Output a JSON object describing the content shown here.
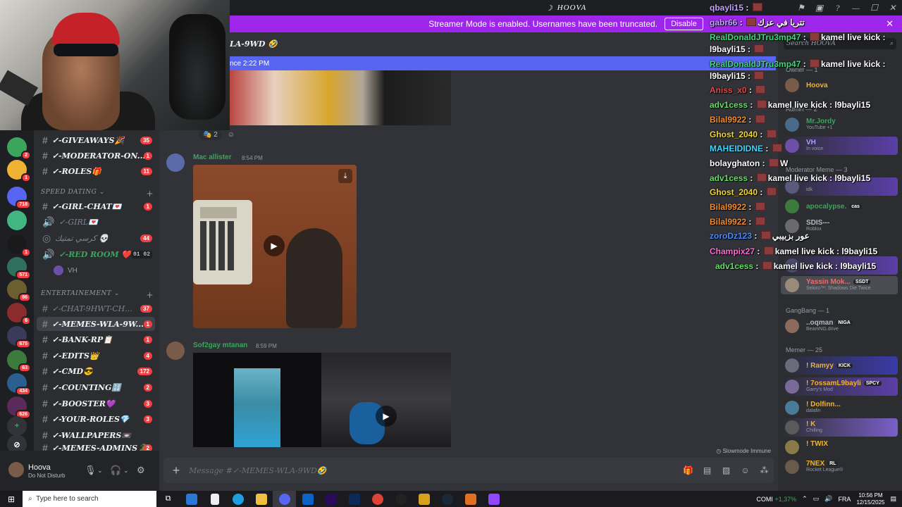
{
  "window": {
    "title": "HOOVA"
  },
  "banner": {
    "text": "Streamer Mode is enabled. Usernames have been truncated.",
    "button": "Disable"
  },
  "channel_header": {
    "title": "LA-9WD 🤣"
  },
  "new_messages": {
    "text": "nce 2:22 PM"
  },
  "reaction": {
    "count": "2"
  },
  "rail": {
    "servers": [
      {
        "badge": "2",
        "color": "#3ba55d"
      },
      {
        "badge": "1",
        "color": "#f0b232"
      },
      {
        "badge": "718",
        "color": "#5865f2"
      },
      {
        "badge": "",
        "color": "#43b581"
      },
      {
        "badge": "1",
        "color": "#1a1a1a"
      },
      {
        "badge": "571",
        "color": "#2f6f5e"
      },
      {
        "badge": "86",
        "color": "#6b5f2f"
      },
      {
        "badge": "6",
        "color": "#8b2b2b"
      },
      {
        "badge": "675",
        "color": "#3a3a5a"
      },
      {
        "badge": "63",
        "color": "#3d7a3d"
      },
      {
        "badge": "434",
        "color": "#2a5f8f"
      },
      {
        "badge": "626",
        "color": "#5a2a5a"
      }
    ]
  },
  "channels": {
    "items": [
      {
        "label": "✓-GIVEAWAYS🎉",
        "count": "35"
      },
      {
        "label": "✓-MODERATOR-ON...",
        "count": "1"
      },
      {
        "label": "✓-ROLES🎁",
        "count": "11"
      },
      {
        "label": "✓-GIRL-CHAT💌",
        "count": "1"
      },
      {
        "label": "✓-GIRL💌",
        "count": ""
      },
      {
        "label": "كرسي تمتيك 💀",
        "count": "44"
      },
      {
        "label": "✓-RED ROOM ❤️",
        "count": ""
      },
      {
        "label": "✓-CHAT-9HWT-CH...",
        "count": "37"
      },
      {
        "label": "✓-MEMES-WLA-9W...",
        "count": "1"
      },
      {
        "label": "✓-BANK-RP📋",
        "count": "1"
      },
      {
        "label": "✓-EDITS👑",
        "count": "4"
      },
      {
        "label": "✓-CMD😎",
        "count": "172"
      },
      {
        "label": "✓-COUNTING🔢",
        "count": "2"
      },
      {
        "label": "✓-BOOSTER💜",
        "count": "3"
      },
      {
        "label": "✓-YOUR-ROLES💎",
        "count": "3"
      },
      {
        "label": "✓-WALLPAPERS📼",
        "count": ""
      },
      {
        "label": "✓-MEMES-ADMINS🐊",
        "count": "2"
      }
    ],
    "cat_speed": "SPEED DATING",
    "cat_ent": "ENTERTAINEMENT",
    "vc_user": "VH",
    "vc_counts": [
      "01",
      "02"
    ]
  },
  "user": {
    "name": "Hoova",
    "status": "Do Not Disturb"
  },
  "messages": [
    {
      "author": "Mac allister",
      "time": "8:54 PM",
      "color": "#3ba55d"
    },
    {
      "author": "Sof2gay mtanan",
      "time": "8:59 PM",
      "color": "#3ba55d"
    }
  ],
  "slowmode": "Slowmode Immune",
  "composer": {
    "placeholder": "Message #✓-MEMES-WLA-9WD🤣"
  },
  "stream_chat": [
    {
      "user": "qbayli15",
      "msg": "",
      "color": "#c7a3ff"
    },
    {
      "user": "gabr66",
      "msg": "تتريا في عزك",
      "color": "#c7a3ff"
    },
    {
      "user": "RealDonaldJTru3mp47",
      "msg": "kamel live kick :",
      "color": "#3fd97a"
    },
    {
      "user": "l9bayli15",
      "msg": "",
      "color": "#ffffff"
    },
    {
      "user": "RealDonaldJTru3mp47",
      "msg": "kamel live kick :",
      "color": "#3fd97a"
    },
    {
      "user": "l9bayli15",
      "msg": "",
      "color": "#ffffff"
    },
    {
      "user": "Aniss_x0",
      "msg": "",
      "color": "#e04a4a"
    },
    {
      "user": "adv1cess",
      "msg": "kamel live kick : l9bayli15",
      "color": "#5fe35f"
    },
    {
      "user": "Bilal9922",
      "msg": "",
      "color": "#f28c2f"
    },
    {
      "user": "Ghost_2040",
      "msg": "",
      "color": "#f2d52f"
    },
    {
      "user": "MAHEIDIDNE",
      "msg": "",
      "color": "#3fd9ff"
    },
    {
      "user": "bolayghaton",
      "msg": "W",
      "color": "#ffffff"
    },
    {
      "user": "adv1cess",
      "msg": "kamel live kick : l9bayli15",
      "color": "#5fe35f"
    },
    {
      "user": "Ghost_2040",
      "msg": "",
      "color": "#f2d52f"
    },
    {
      "user": "Bilal9922",
      "msg": "",
      "color": "#f28c2f"
    },
    {
      "user": "Bilal9922",
      "msg": "",
      "color": "#f28c2f"
    },
    {
      "user": "zoroDz123",
      "msg": "عور بزبيبي",
      "color": "#4a8cff"
    },
    {
      "user": "Champix27",
      "msg": "kamel live kick : l9bayli15",
      "color": "#ff6ad5"
    },
    {
      "user": "adv1cess",
      "msg": "kamel live kick : l9bayli15",
      "color": "#5fe35f"
    }
  ],
  "members": {
    "search": "Search HOOVA",
    "groups": [
      {
        "role": "Owner — 1",
        "members": [
          {
            "name": "Hoova",
            "status": "",
            "color": "#f0b232"
          }
        ]
      },
      {
        "role": "Admin — 2",
        "members": [
          {
            "name": "Mr.Jordy",
            "status": "YouTube +1",
            "color": "#3ba55d"
          },
          {
            "name": "VH",
            "status": "In voice",
            "color": "#b19cff"
          }
        ]
      },
      {
        "role": "Moderator Meme — 3",
        "members": [
          {
            "name": "",
            "status": "idk",
            "color": "#b19cff"
          },
          {
            "name": "apocalypse.",
            "status": "",
            "color": "#3ba55d",
            "tag": "cas"
          },
          {
            "name": "SDIS---",
            "status": "Roblox",
            "color": "#b5bac1"
          },
          {
            "name": "",
            "status": "",
            "color": "#b5bac1"
          },
          {
            "name": "Yassin Mok...",
            "status": "Sekiro™: Shadows Die Twice",
            "color": "#f26b6b",
            "tag": "SSDT"
          }
        ]
      },
      {
        "role": "GangBang — 1",
        "members": [
          {
            "name": "..oqman",
            "status": "BeamNG.drive",
            "color": "#b5bac1",
            "tag": "NIGA"
          }
        ]
      },
      {
        "role": "Memer — 25",
        "members": [
          {
            "name": "! Ramyy",
            "status": "",
            "color": "#f0b232",
            "tag": "KICK"
          },
          {
            "name": "! 7ossamL9bayli",
            "status": "Garry's Mod",
            "color": "#f0b232",
            "tag": "SPCY"
          },
          {
            "name": "! Dolfinn...",
            "status": "dalafin",
            "color": "#f0b232"
          },
          {
            "name": "! K",
            "status": "Chilling",
            "color": "#f0b232"
          },
          {
            "name": "! TWIX",
            "status": "",
            "color": "#f0b232"
          },
          {
            "name": "7NEX",
            "status": "Rocket League®",
            "color": "#f0b232",
            "tag": "RL"
          }
        ]
      }
    ]
  },
  "taskbar": {
    "search": "Type here to search",
    "tray_app": "COMI",
    "tray_pct": "+1,37%",
    "lang": "FRA",
    "time": "10:56 PM",
    "date": "12/15/2025"
  }
}
